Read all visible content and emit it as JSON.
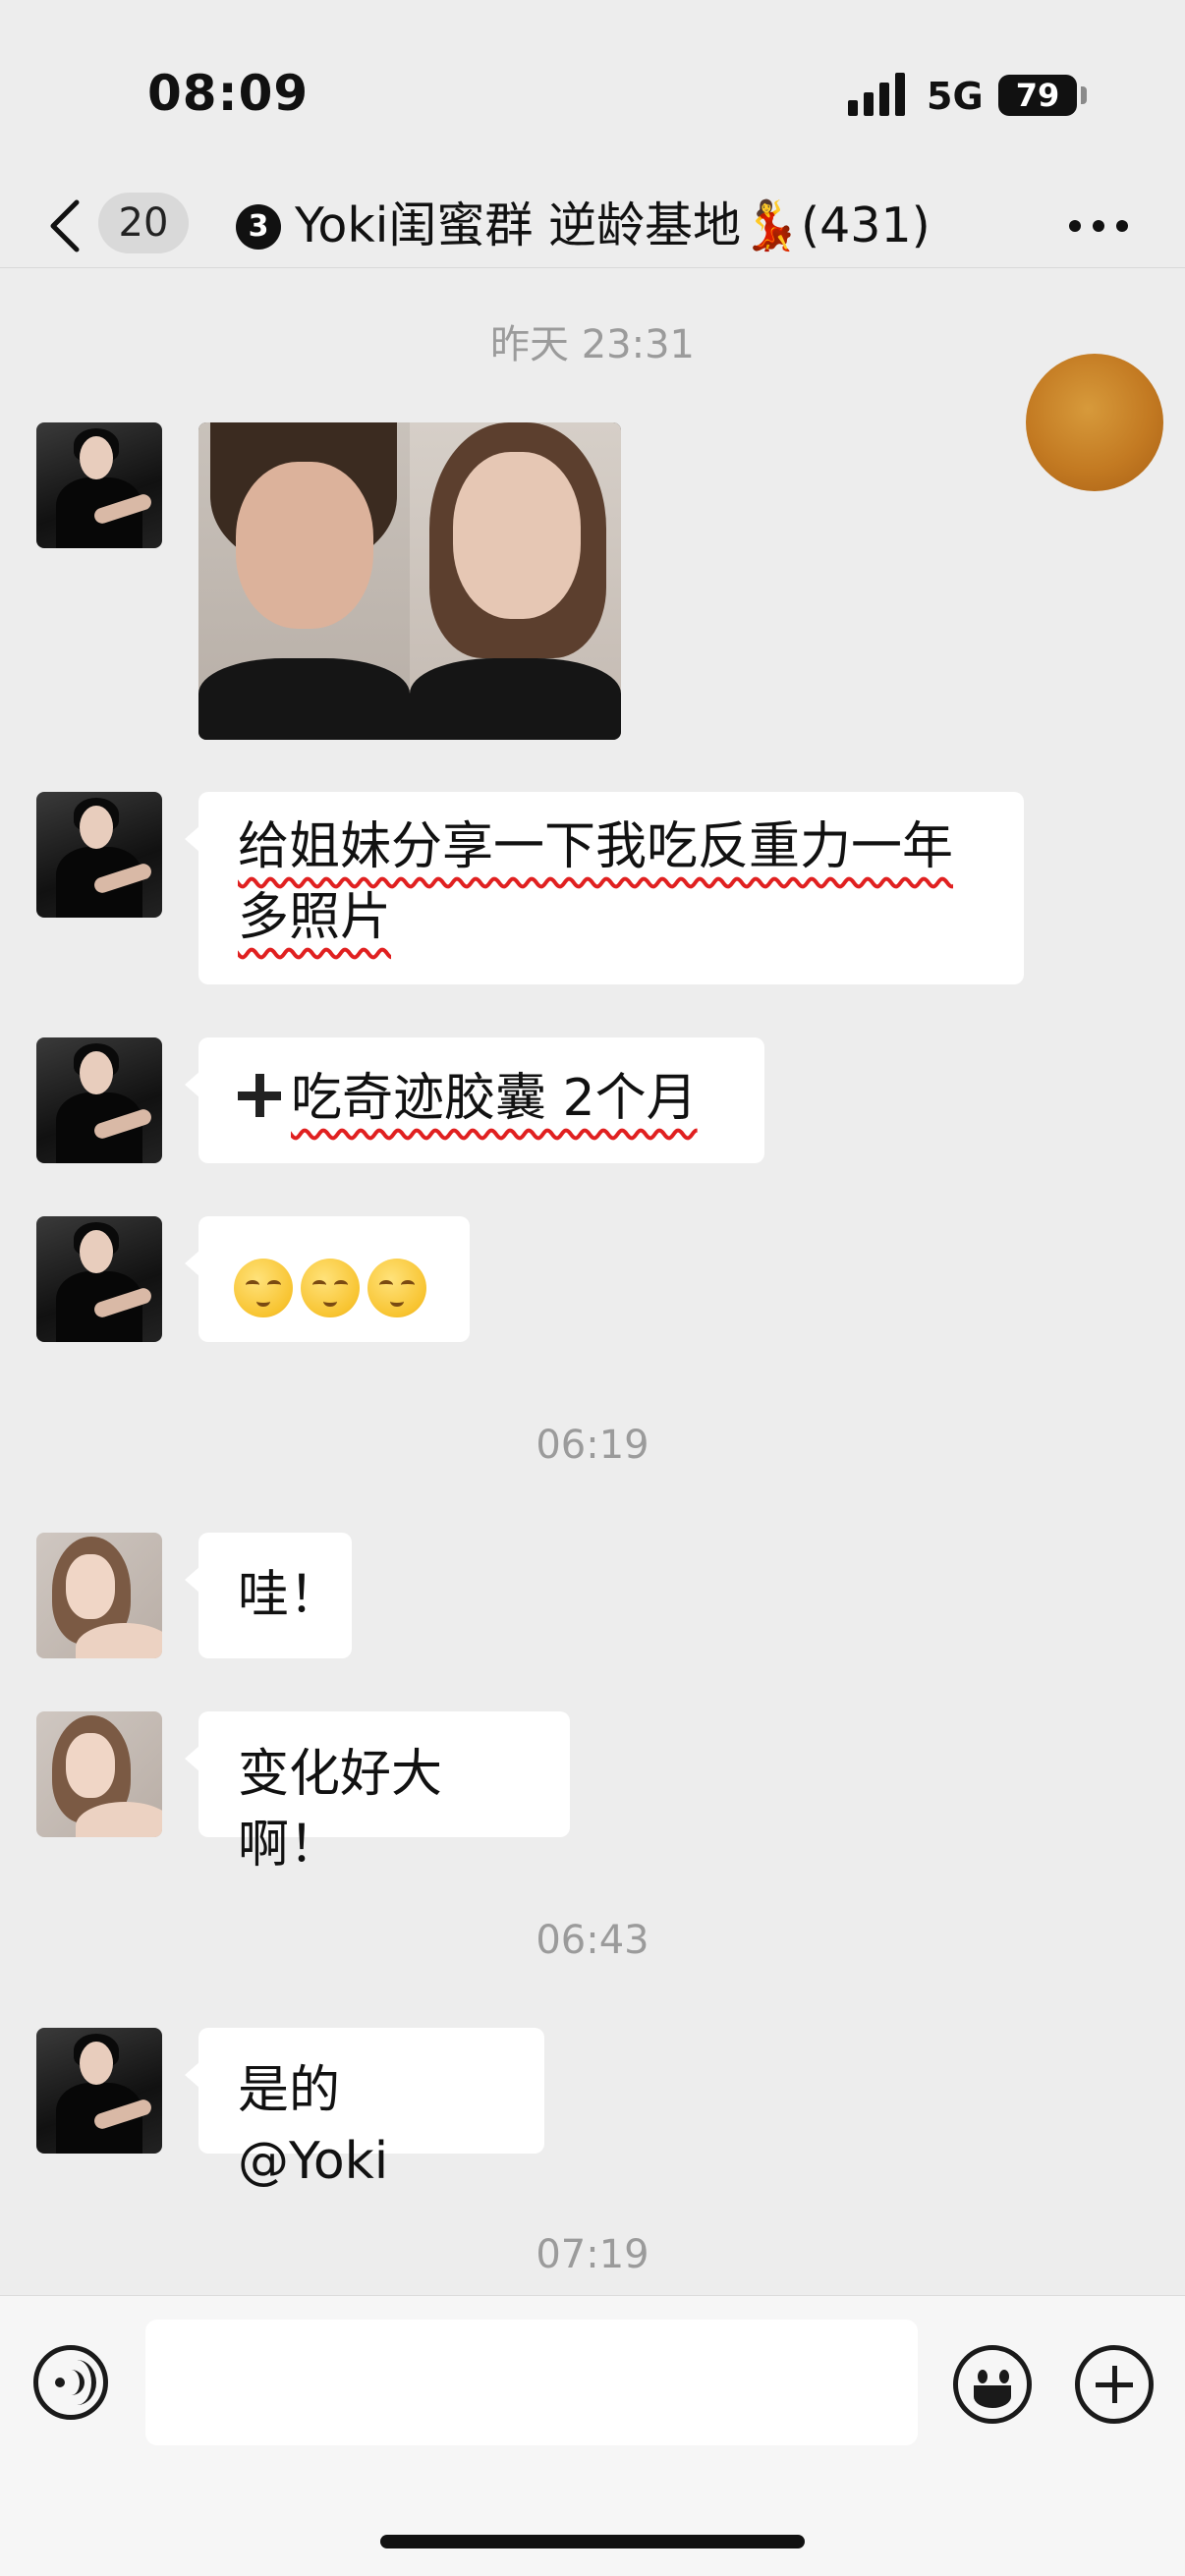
{
  "status_bar": {
    "time": "08:09",
    "network": "5G",
    "battery": "79"
  },
  "nav": {
    "unread_count": "20",
    "title_badge": "3",
    "title": "Yoki闺蜜群 逆龄基地💃(431)"
  },
  "messages": [
    {
      "type": "timestamp",
      "text": "昨天 23:31"
    },
    {
      "type": "image",
      "sender": "member-a",
      "description_icon": "photo"
    },
    {
      "type": "text",
      "sender": "member-a",
      "text": "给姐妹分享一下我吃反重力一年多照片"
    },
    {
      "type": "text",
      "sender": "member-a",
      "text": "吃奇迹胶囊 2个月"
    },
    {
      "type": "emoji",
      "sender": "member-a",
      "emojis": [
        "😌",
        "😌",
        "😌"
      ]
    },
    {
      "type": "timestamp",
      "text": "06:19"
    },
    {
      "type": "text",
      "sender": "member-b",
      "text": "哇！"
    },
    {
      "type": "text",
      "sender": "member-b",
      "text": "变化好大啊！"
    },
    {
      "type": "timestamp",
      "text": "06:43"
    },
    {
      "type": "text",
      "sender": "member-a",
      "text": "是的 @Yoki"
    },
    {
      "type": "timestamp",
      "text": "07:19"
    }
  ],
  "input_bar": {
    "value": "",
    "placeholder": ""
  },
  "colors": {
    "background": "#ededed",
    "bubble": "#ffffff",
    "highlight_underline": "#e02020",
    "input_bar": "#f6f6f6"
  }
}
